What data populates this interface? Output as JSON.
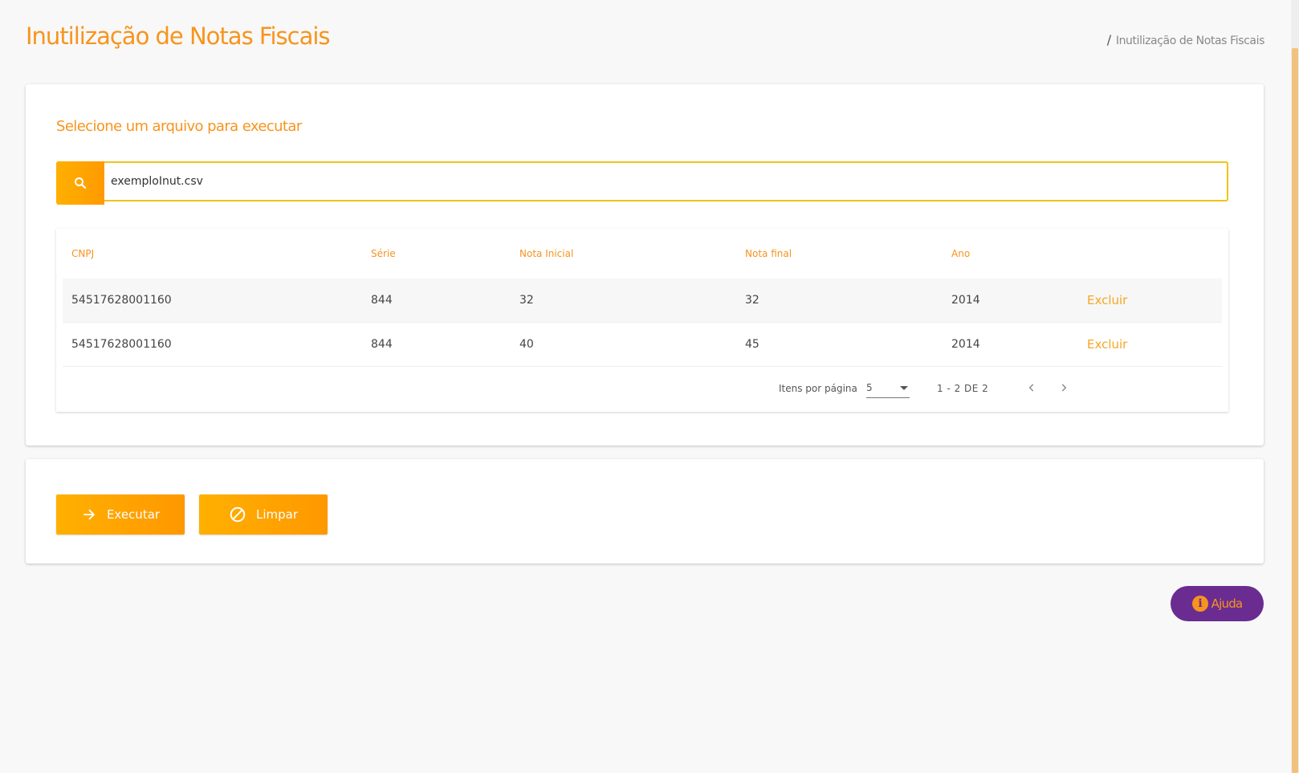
{
  "header": {
    "title": "Inutilização de Notas Fiscais",
    "breadcrumb_separator": "/",
    "breadcrumb_current": "Inutilização de Notas Fiscais"
  },
  "upload": {
    "section_title": "Selecione um arquivo para executar",
    "file_value": "exemploInut.csv",
    "search_icon": "search-icon"
  },
  "table": {
    "columns": [
      "CNPJ",
      "Série",
      "Nota Inicial",
      "Nota final",
      "Ano"
    ],
    "rows": [
      {
        "cnpj": "54517628001160",
        "serie": "844",
        "nota_inicial": "32",
        "nota_final": "32",
        "ano": "2014",
        "action": "Excluir"
      },
      {
        "cnpj": "54517628001160",
        "serie": "844",
        "nota_inicial": "40",
        "nota_final": "45",
        "ano": "2014",
        "action": "Excluir"
      }
    ]
  },
  "paginator": {
    "items_per_page_label": "Itens por página",
    "page_size": "5",
    "range_label": "1 - 2 DE 2",
    "prev_icon": "chevron-left-icon",
    "next_icon": "chevron-right-icon"
  },
  "actions": {
    "execute_label": "Executar",
    "execute_icon": "arrow-right-icon",
    "clear_label": "Limpar",
    "clear_icon": "block-icon"
  },
  "help": {
    "label": "Ajuda",
    "icon_glyph": "i",
    "icon": "info-icon"
  },
  "colors": {
    "accent": "#f7941d",
    "button_gradient_start": "#ffb000",
    "button_gradient_end": "#ff9800",
    "search_border": "#f0c419",
    "help_background": "#6a2c91"
  }
}
